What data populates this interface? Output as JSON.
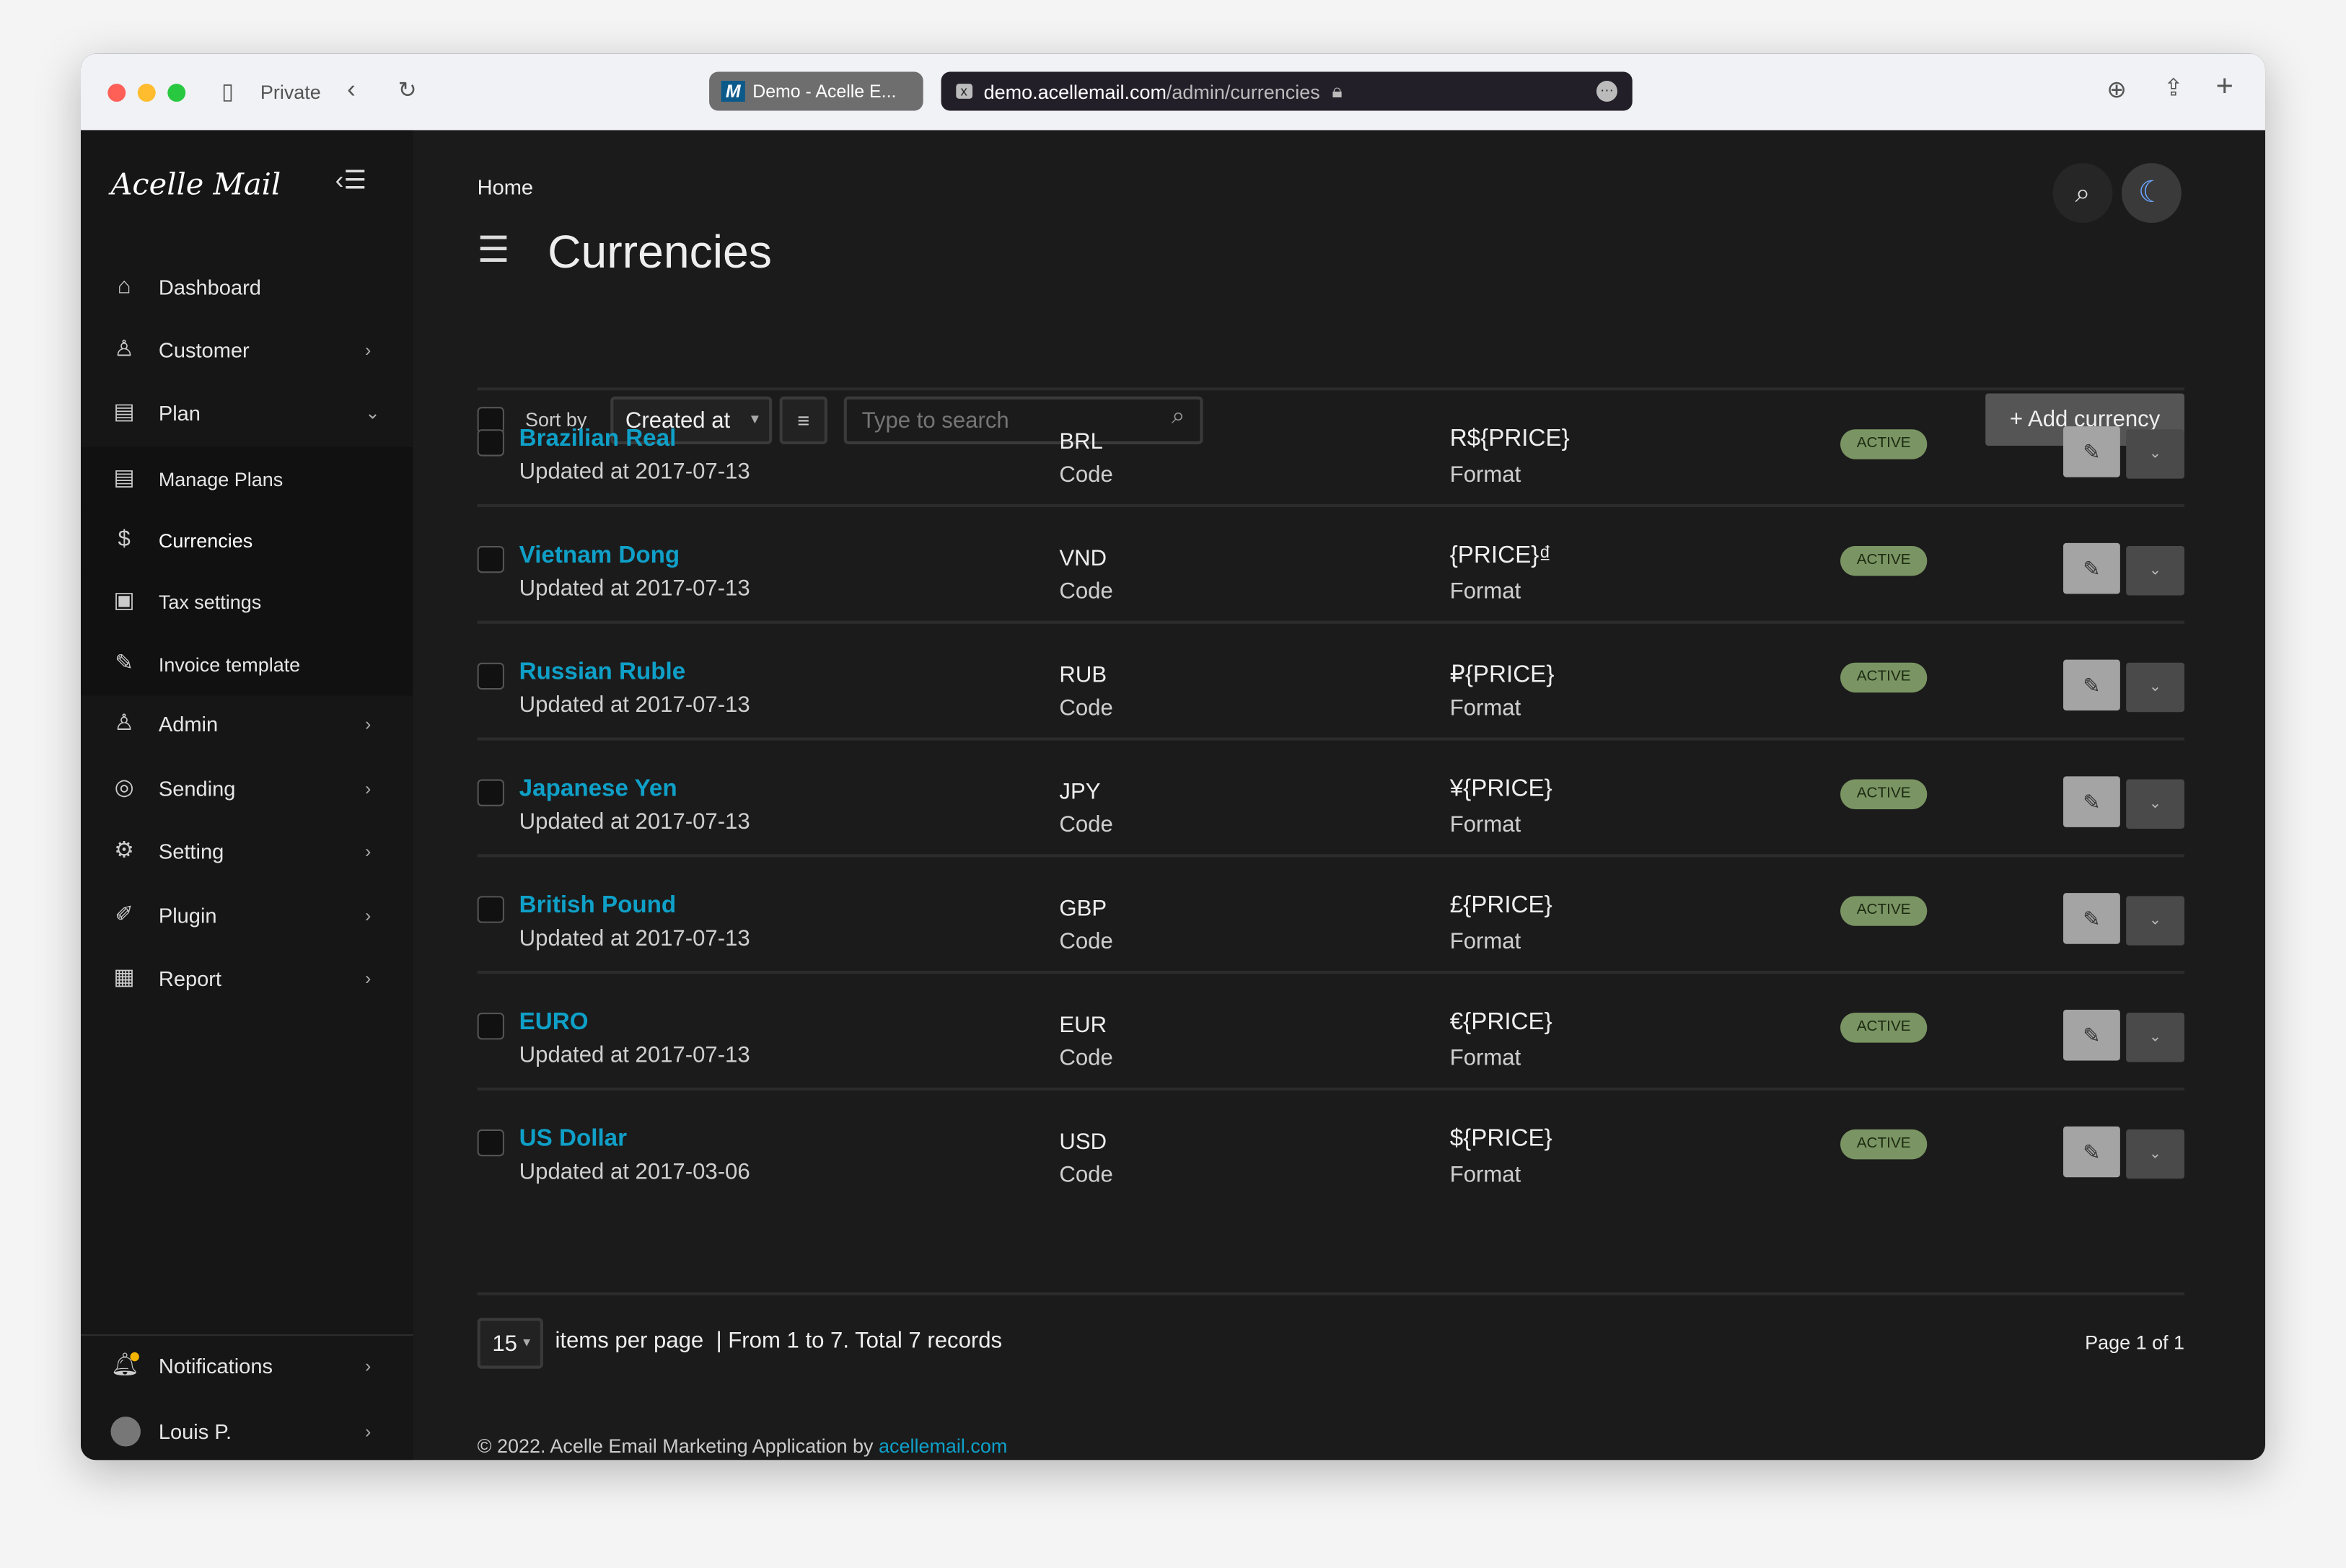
{
  "browser": {
    "mode": "Private",
    "tab_title": "Demo - Acelle E...",
    "url_host": "demo.acellemail.com",
    "url_path": "/admin/currencies"
  },
  "sidebar": {
    "logo": "Acelle Mail",
    "items": [
      {
        "label": "Dashboard",
        "icon": "home-icon"
      },
      {
        "label": "Customer",
        "icon": "user-icon"
      },
      {
        "label": "Plan",
        "icon": "plan-icon"
      },
      {
        "label": "Manage Plans",
        "icon": "plan-icon"
      },
      {
        "label": "Currencies",
        "icon": "dollar-icon"
      },
      {
        "label": "Tax settings",
        "icon": "tax-icon"
      },
      {
        "label": "Invoice template",
        "icon": "invoice-icon"
      },
      {
        "label": "Admin",
        "icon": "admin-icon"
      },
      {
        "label": "Sending",
        "icon": "sending-icon"
      },
      {
        "label": "Setting",
        "icon": "gear-icon"
      },
      {
        "label": "Plugin",
        "icon": "plugin-icon"
      },
      {
        "label": "Report",
        "icon": "report-icon"
      }
    ],
    "notifications": "Notifications",
    "user": "Louis P."
  },
  "header": {
    "breadcrumb": "Home",
    "title": "Currencies"
  },
  "toolbar": {
    "sort_by": "Sort by",
    "sort_value": "Created at",
    "search_placeholder": "Type to search",
    "add_label": "+ Add currency"
  },
  "rows": [
    {
      "name": "Brazilian Real",
      "updated": "Updated at 2017-07-13",
      "code": "BRL",
      "code_label": "Code",
      "format": "R${PRICE}",
      "format_label": "Format",
      "status": "ACTIVE"
    },
    {
      "name": "Vietnam Dong",
      "updated": "Updated at 2017-07-13",
      "code": "VND",
      "code_label": "Code",
      "format": "{PRICE}₫",
      "format_label": "Format",
      "status": "ACTIVE"
    },
    {
      "name": "Russian Ruble",
      "updated": "Updated at 2017-07-13",
      "code": "RUB",
      "code_label": "Code",
      "format": "₽{PRICE}",
      "format_label": "Format",
      "status": "ACTIVE"
    },
    {
      "name": "Japanese Yen",
      "updated": "Updated at 2017-07-13",
      "code": "JPY",
      "code_label": "Code",
      "format": "¥{PRICE}",
      "format_label": "Format",
      "status": "ACTIVE"
    },
    {
      "name": "British Pound",
      "updated": "Updated at 2017-07-13",
      "code": "GBP",
      "code_label": "Code",
      "format": "£{PRICE}",
      "format_label": "Format",
      "status": "ACTIVE"
    },
    {
      "name": "EURO",
      "updated": "Updated at 2017-07-13",
      "code": "EUR",
      "code_label": "Code",
      "format": "€{PRICE}",
      "format_label": "Format",
      "status": "ACTIVE"
    },
    {
      "name": "US Dollar",
      "updated": "Updated at 2017-03-06",
      "code": "USD",
      "code_label": "Code",
      "format": "${PRICE}",
      "format_label": "Format",
      "status": "ACTIVE"
    }
  ],
  "pagination": {
    "per_page": "15",
    "per_page_label": "items per page",
    "summary": "| From 1 to 7. Total 7 records",
    "page": "Page 1 of 1"
  },
  "footer": {
    "text": "© 2022. Acelle Email Marketing Application by ",
    "link": "acellemail.com"
  },
  "colors": {
    "accent": "#0fa0c8",
    "active_badge": "#7a9563",
    "bg": "#1b1b1b",
    "sidebar": "#161616"
  }
}
